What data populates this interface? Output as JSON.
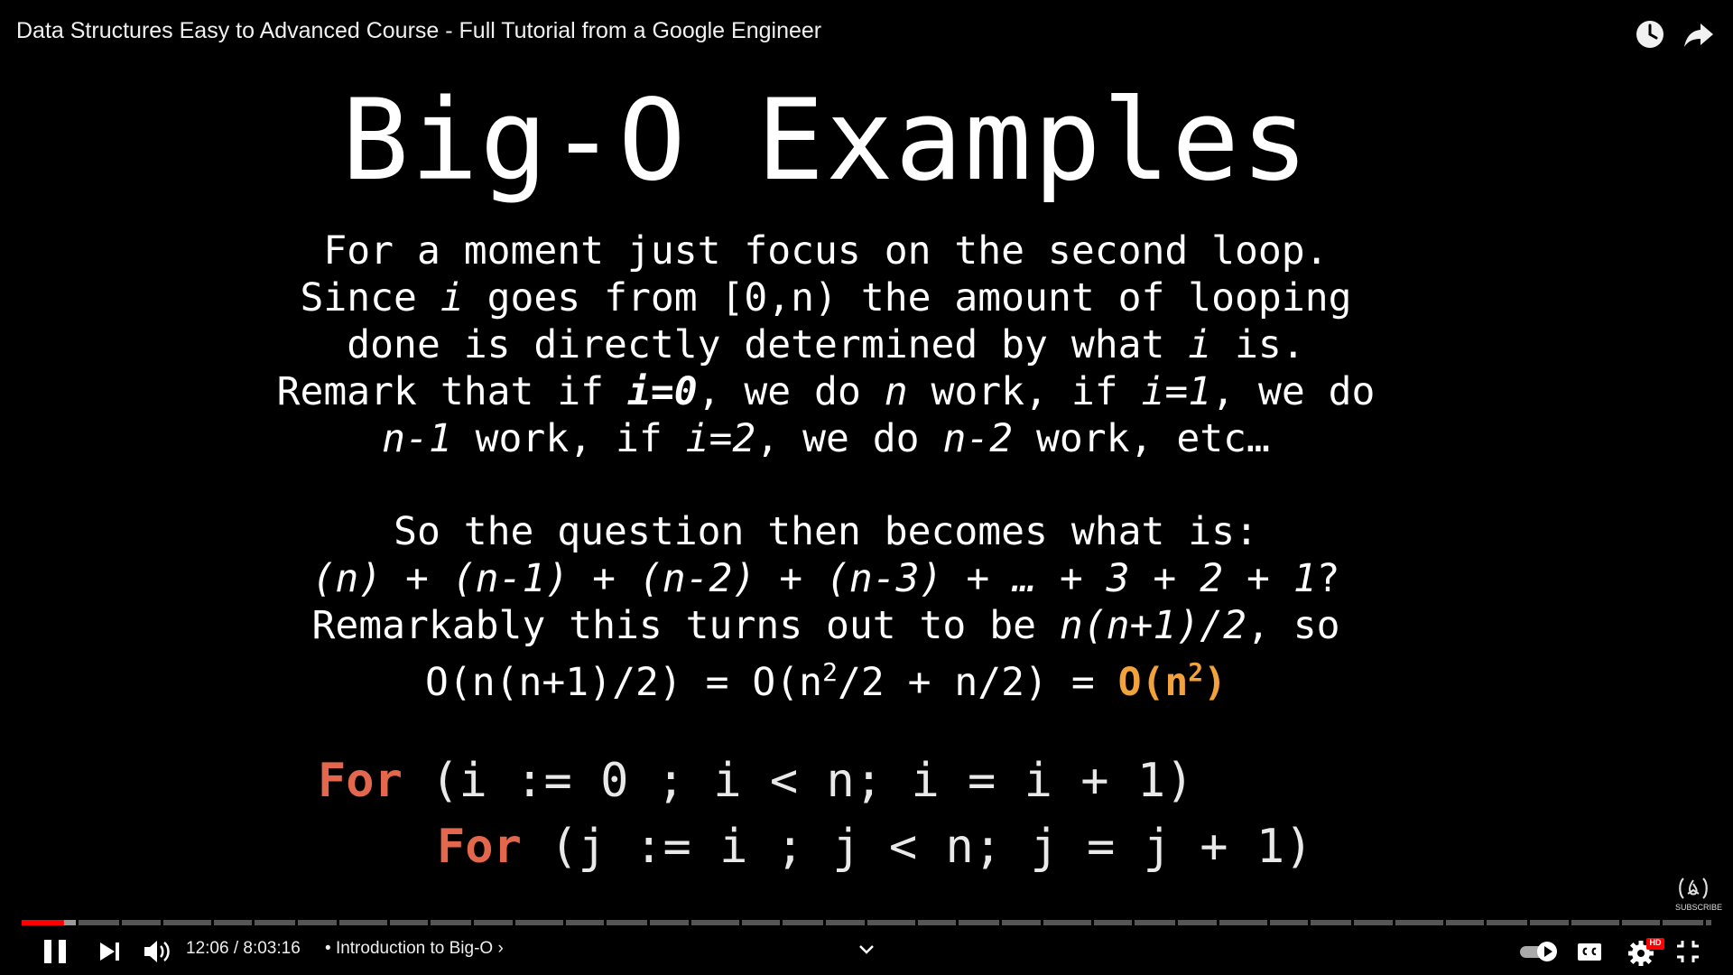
{
  "player": {
    "title": "Data Structures Easy to Advanced Course - Full Tutorial from a Google Engineer",
    "current_time": "12:06",
    "duration": "8:03:16",
    "time_separator": " / ",
    "chapter_bullet": "•",
    "chapter": "Introduction to Big-O",
    "chapter_chevron": "›",
    "progress_fraction": 0.025,
    "accent_color": "#ff0000",
    "hd_badge": "HD",
    "watermark_text": "SUBSCRIBE",
    "icons": [
      "watch-later-icon",
      "share-icon",
      "pause-icon",
      "next-icon",
      "volume-icon",
      "chevron-down-icon",
      "autoplay-toggle-icon",
      "captions-icon",
      "settings-icon",
      "exit-fullscreen-icon"
    ]
  },
  "slide": {
    "title": "Big-O Examples",
    "para1": {
      "l1": "For a moment just focus on the second loop.",
      "l2_a": "Since ",
      "l2_i": "i",
      "l2_b": " goes from [0,n) the amount of looping",
      "l3_a": "done is directly determined by what ",
      "l3_i": "i",
      "l3_b": " is.",
      "l4_a": "Remark that if ",
      "l4_i0": "i=0",
      "l4_b": ", we do ",
      "l4_n": "n",
      "l4_c": " work, if ",
      "l4_i1": "i=1",
      "l4_d": ", we do",
      "l5_n1": "n-1",
      "l5_a": " work, if ",
      "l5_i2": "i=2",
      "l5_b": ", we do ",
      "l5_n2": "n-2",
      "l5_c": " work, etc…"
    },
    "para2": {
      "l1": "So the question then becomes what is:",
      "l2": "(n) + (n-1) + (n-2) + (n-3) + … + 3 + 2 + 1",
      "l2_q": "?",
      "l3_a": "Remarkably this turns out to be ",
      "l3_f": "n(n+1)/2",
      "l3_b": ", so",
      "l4_a": "O(n(n+1)/2) = O(n",
      "l4_sup1": "2",
      "l4_b": "/2 + n/2) = ",
      "l4_res": "O(n",
      "l4_sup2": "2",
      "l4_res_end": ")"
    },
    "code": {
      "kw": "For",
      "line1": " (i := 0 ; i < n; i = i + 1)",
      "line2": " (j := i ; j < n; j = j + 1)"
    }
  }
}
